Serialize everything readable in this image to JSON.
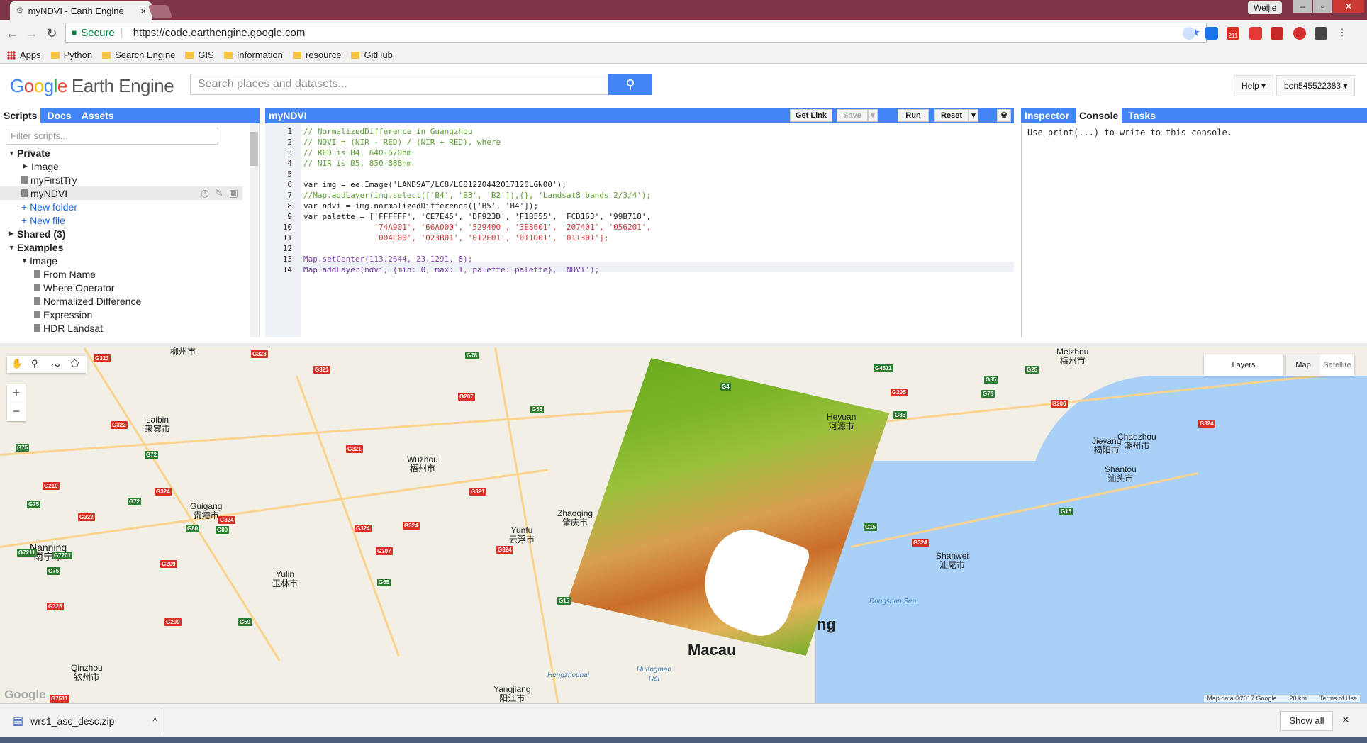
{
  "browser": {
    "tab_title": "myNDVI - Earth Engine",
    "tab_close": "×",
    "profile_name": "Weijie",
    "secure_label": "Secure",
    "url": "https://code.earthengine.google.com",
    "bookmarks": [
      "Apps",
      "Python",
      "Search Engine",
      "GIS",
      "Information",
      "resource",
      "GitHub"
    ],
    "gmail_badge": "211"
  },
  "header": {
    "logo_google": [
      "G",
      "o",
      "o",
      "g",
      "l",
      "e"
    ],
    "logo_product": "Earth Engine",
    "search_placeholder": "Search places and datasets...",
    "help_label": "Help ▾",
    "account_label": "ben545522383 ▾"
  },
  "left_panel": {
    "tabs": [
      "Scripts",
      "Docs",
      "Assets"
    ],
    "filter_placeholder": "Filter scripts...",
    "tree": [
      {
        "label": "Private",
        "arrow": "▼"
      },
      {
        "label": "Image",
        "arrow": "▶"
      },
      {
        "label": "myFirstTry"
      },
      {
        "label": "myNDVI"
      },
      {
        "label": "+ New folder"
      },
      {
        "label": "+ New file"
      },
      {
        "label": "Shared  (3)",
        "arrow": "▶"
      },
      {
        "label": "Examples",
        "arrow": "▼"
      },
      {
        "label": "Image",
        "arrow": "▼"
      },
      {
        "label": "From Name"
      },
      {
        "label": "Where Operator"
      },
      {
        "label": "Normalized Difference"
      },
      {
        "label": "Expression"
      },
      {
        "label": "HDR Landsat"
      }
    ]
  },
  "editor": {
    "title": "myNDVI",
    "buttons": {
      "get_link": "Get Link",
      "save": "Save",
      "run": "Run",
      "reset": "Reset"
    },
    "line_numbers": [
      "1",
      "2",
      "3",
      "4",
      "5",
      "6",
      "7",
      "8",
      "9",
      "10",
      "11",
      "12",
      "13",
      "14"
    ],
    "lines": [
      "// NormalizedDifference in Guangzhou",
      "// NDVI = (NIR - RED) / (NIR + RED), where",
      "// RED is B4, 640-670nm",
      "// NIR is B5, 850-888nm",
      "",
      "var img = ee.Image('LANDSAT/LC8/LC81220442017120LGN00');",
      "//Map.addLayer(img.select(['B4', 'B3', 'B2']),{}, 'Landsat8 bands 2/3/4');",
      "var ndvi = img.normalizedDifference(['B5', 'B4']);",
      "var palette = ['FFFFFF', 'CE7E45', 'DF923D', 'F1B555', 'FCD163', '99B718',",
      "               '74A901', '66A000', '529400', '3E8601', '207401', '056201',",
      "               '004C00', '023B01', '012E01', '011D01', '011301'];",
      "",
      "Map.setCenter(113.2644, 23.1291, 8);",
      "Map.addLayer(ndvi, {min: 0, max: 1, palette: palette}, 'NDVI');"
    ]
  },
  "right_panel": {
    "tabs": [
      "Inspector",
      "Console",
      "Tasks"
    ],
    "console_text": "Use print(...) to write to this console."
  },
  "map": {
    "layers_label": "Layers",
    "map_type": [
      "Map",
      "Satellite"
    ],
    "zoom_in": "+",
    "zoom_out": "−",
    "attribution": [
      "Map data ©2017 Google",
      "20 km",
      "Terms of Use"
    ],
    "watermark": "Google",
    "cities": [
      {
        "name": "柳州市"
      },
      {
        "name": "Laibin\n来宾市"
      },
      {
        "name": "Wuzhou\n梧州市"
      },
      {
        "name": "Guigang\n贵港市"
      },
      {
        "name": "Nanning\n南宁市"
      },
      {
        "name": "Yulin\n玉林市"
      },
      {
        "name": "Zhaoqing\n肇庆市"
      },
      {
        "name": "Yunfu\n云浮市"
      },
      {
        "name": "Heyuan\n河源市"
      },
      {
        "name": "Meizhou\n梅州市"
      },
      {
        "name": "Jieyang\n揭阳市"
      },
      {
        "name": "Chaozhou\n潮州市"
      },
      {
        "name": "Shantou\n汕头市"
      },
      {
        "name": "Shanwei\n汕尾市"
      },
      {
        "name": "Yangjiang\n阳江市"
      },
      {
        "name": "Qinzhou\n钦州市"
      },
      {
        "name": "Macau"
      },
      {
        "name": "ng"
      },
      {
        "name": "Dongshan Sea"
      },
      {
        "name": "Huangmao\nHai"
      },
      {
        "name": "Hengzhouhai"
      }
    ],
    "shields": [
      "G323",
      "G323",
      "G78",
      "G321",
      "G322",
      "G207",
      "G4",
      "G4511",
      "G205",
      "G35",
      "G25",
      "G75",
      "G72",
      "G55",
      "G35",
      "G78",
      "G206",
      "G324",
      "G321",
      "G210",
      "G324",
      "G72",
      "G75",
      "G322",
      "G324",
      "G80",
      "G80",
      "G321",
      "G324",
      "G324",
      "G324",
      "G15",
      "G324",
      "G15",
      "G7211",
      "G7201",
      "G75",
      "G209",
      "G207",
      "G65",
      "G15",
      "G59",
      "G325",
      "G209",
      "G7511"
    ]
  },
  "downloads": {
    "filename": "wrs1_asc_desc.zip",
    "chevron": "^",
    "show_all": "Show all",
    "close": "✕"
  }
}
